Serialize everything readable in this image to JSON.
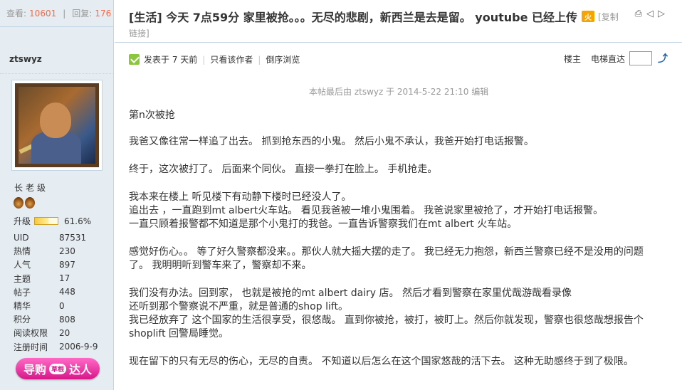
{
  "sidebar": {
    "views_label": "查看:",
    "views_value": "10601",
    "replies_label": "回复:",
    "replies_value": "176",
    "author": "ztswyz",
    "rank": "长老级",
    "upgrade_label": "升级",
    "upgrade_progress": 61.6,
    "upgrade_percent": "61.6%",
    "profile": [
      {
        "key": "UID",
        "value": "87531"
      },
      {
        "key": "热情",
        "value": "230"
      },
      {
        "key": "人气",
        "value": "897"
      },
      {
        "key": "主题",
        "value": "17"
      },
      {
        "key": "帖子",
        "value": "448"
      },
      {
        "key": "精华",
        "value": "0"
      },
      {
        "key": "积分",
        "value": "808"
      },
      {
        "key": "阅读权限",
        "value": "20"
      },
      {
        "key": "注册时间",
        "value": "2006-9-9"
      }
    ],
    "badge_left": "导购",
    "badge_mid": "草根",
    "badge_right": "达人"
  },
  "thread": {
    "title": "[生活] 今天 7点59分 家里被抢。。。无尽的悲剧，新西兰是去是留。 youtube 已经上传",
    "hot_icon_text": "火",
    "copy_label": "[复制",
    "link_label": "链接]"
  },
  "post_meta": {
    "posted": "发表于 7 天前",
    "only_author": "只看该作者",
    "reverse": "倒序浏览",
    "floor": "楼主",
    "jump_label": "电梯直达"
  },
  "edit_note": "本帖最后由 ztswyz 于 2014-5-22 21:10 编辑",
  "content": {
    "p1": "第n次被抢",
    "p2": "我爸又像往常一样追了出去。 抓到抢东西的小鬼。 然后小鬼不承认，我爸开始打电话报警。",
    "p3": "终于，这次被打了。 后面来个同伙。 直接一拳打在脸上。 手机抢走。",
    "p4_l1": "我本来在楼上 听见楼下有动静下楼时已经没人了。",
    "p4_l2": "追出去 ，一直跑到mt albert火车站。 看见我爸被一堆小鬼围着。 我爸说家里被抢了，才开始打电话报警。",
    "p4_l3": "一直只顾着报警都不知道是那个小鬼打的我爸。一直告诉警察我们在mt albert 火车站。",
    "p5_l1": "感觉好伤心。。 等了好久警察都没来。。那伙人就大摇大摆的走了。 我已经无力抱怨，新西兰警察已经不是没用的问题",
    "p5_l2": "了。 我明明听到警车来了，警察却不来。",
    "p6_l1": "我们没有办法。回到家， 也就是被抢的mt albert dairy 店。 然后才看到警察在家里优哉游哉看录像",
    "p6_l2": "还听到那个警察说不严重，就是普通的shop lift。",
    "p6_l3": "我已经放弃了 这个国家的生活很享受，很悠哉。 直到你被抢，被打，被盯上。然后你就发现，警察也很悠哉想报告个",
    "p6_l4": "shoplift 回警局睡觉。",
    "p7": "现在留下的只有无尽的伤心，无尽的自责。 不知道以后怎么在这个国家悠哉的活下去。 这种无助感终于到了极限。"
  }
}
